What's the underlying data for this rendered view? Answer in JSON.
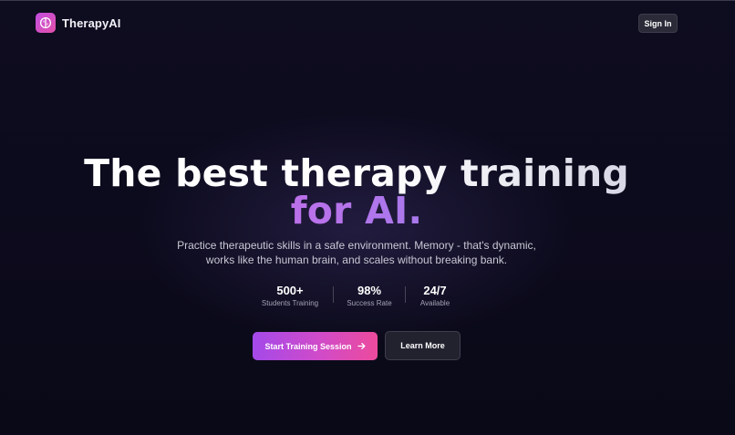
{
  "app": {
    "name": "TherapyAI",
    "logo_icon": "brain-icon"
  },
  "header": {
    "signin_label": "Sign In"
  },
  "hero": {
    "title_line1": "The best therapy training",
    "title_line2": "for AI.",
    "description_line1": "Practice therapeutic skills in a safe environment. Memory - that's dynamic,",
    "description_line2": "works like the human brain, and scales without breaking bank."
  },
  "stats": [
    {
      "value": "500+",
      "label": "Students Training"
    },
    {
      "value": "98%",
      "label": "Success Rate"
    },
    {
      "value": "24/7",
      "label": "Available"
    }
  ],
  "actions": {
    "primary_label": "Start Training Session",
    "primary_icon": "arrow-right-icon",
    "secondary_label": "Learn More"
  },
  "colors": {
    "background": "#0c0b1d",
    "accent_purple": "#a449ea",
    "accent_pink": "#ec4b9c"
  }
}
